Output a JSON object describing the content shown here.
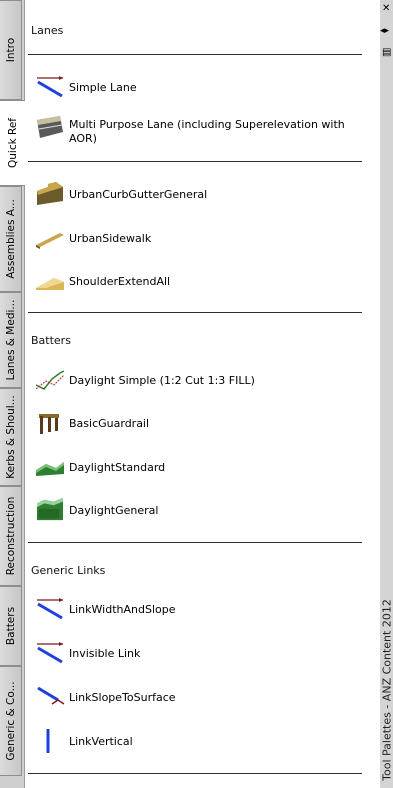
{
  "tabs": [
    {
      "label": "Intro",
      "active": false
    },
    {
      "label": "Quick Ref",
      "active": true
    },
    {
      "label": "Assemblies A...",
      "active": false
    },
    {
      "label": "Lanes & Medi...",
      "active": false
    },
    {
      "label": "Kerbs & Shoul...",
      "active": false
    },
    {
      "label": "Reconstruction",
      "active": false
    },
    {
      "label": "Batters",
      "active": false
    },
    {
      "label": "Generic & Co...",
      "active": false
    }
  ],
  "sections": {
    "lanes": "Lanes",
    "batters": "Batters",
    "generic_links": "Generic Links"
  },
  "tools": {
    "simple_lane": "Simple Lane",
    "multi_purpose_lane": "Multi Purpose Lane (including Superelevation with AOR)",
    "urban_curb_gutter": "UrbanCurbGutterGeneral",
    "urban_sidewalk": "UrbanSidewalk",
    "shoulder_extend_all": "ShoulderExtendAll",
    "daylight_simple": "Daylight Simple (1:2 Cut 1:3 FILL)",
    "basic_guardrail": "BasicGuardrail",
    "daylight_standard": "DaylightStandard",
    "daylight_general": "DaylightGeneral",
    "link_width_slope": "LinkWidthAndSlope",
    "invisible_link": "Invisible Link",
    "link_slope_surface": "LinkSlopeToSurface",
    "link_vertical": "LinkVertical"
  },
  "palette_title": "Tool Palettes - ANZ Content 2012",
  "controls": {
    "close": "✕",
    "autohide": "◂▸",
    "properties": "▤"
  },
  "colors": {
    "link_blue": "#1f3fe0",
    "arrow_red": "#7a1a1a",
    "green": "#2f7d2f",
    "brown": "#8a6a2a"
  }
}
